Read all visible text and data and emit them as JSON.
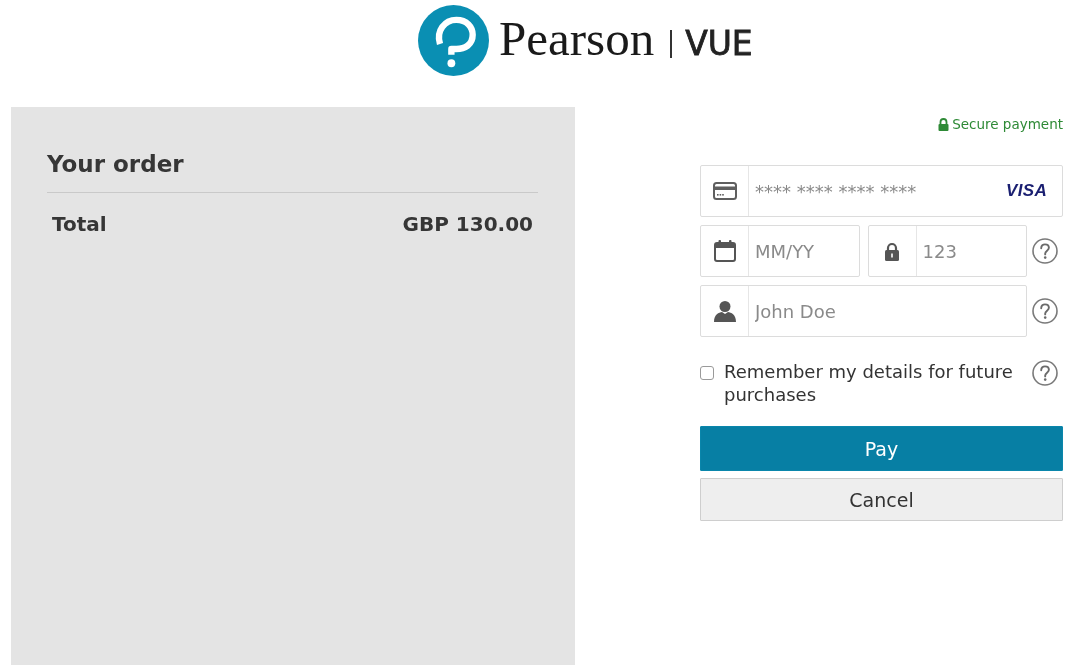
{
  "logo": {
    "brand": "Pearson",
    "product": "VUE"
  },
  "order": {
    "title": "Your order",
    "lines": [
      {
        "label": "Total",
        "amount": "GBP 130.00"
      }
    ]
  },
  "payment": {
    "secure_note": "Secure payment",
    "rows": [
      {
        "help": false,
        "fields": [
          {
            "kind": "card",
            "placeholder": "**** **** **** ****",
            "brand": "VISA"
          }
        ]
      },
      {
        "help": true,
        "fields": [
          {
            "kind": "expiry",
            "placeholder": "MM/YY"
          },
          {
            "kind": "cvc",
            "placeholder": "123"
          }
        ]
      },
      {
        "help": true,
        "fields": [
          {
            "kind": "name",
            "placeholder": "John Doe"
          }
        ]
      }
    ],
    "remember": {
      "label": "Remember my details for future purchases",
      "checked": false,
      "help": true
    },
    "buttons": [
      {
        "kind": "primary",
        "label": "Pay"
      },
      {
        "kind": "secondary",
        "label": "Cancel"
      }
    ]
  }
}
